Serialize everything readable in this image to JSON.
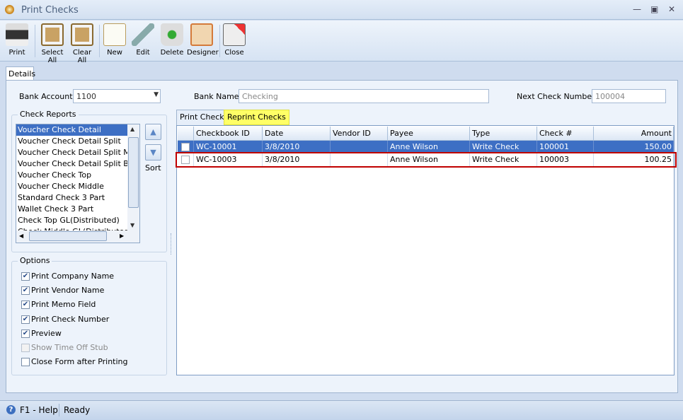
{
  "window": {
    "title": "Print Checks"
  },
  "toolbar": {
    "items": [
      {
        "label": "Print",
        "icon": "printer-icon"
      },
      {
        "label": "Select All",
        "icon": "clipboard-check-icon"
      },
      {
        "label": "Clear All",
        "icon": "clipboard-eraser-icon"
      },
      {
        "label": "New",
        "icon": "new-document-icon"
      },
      {
        "label": "Edit",
        "icon": "wrench-icon"
      },
      {
        "label": "Delete",
        "icon": "recycle-bin-icon"
      },
      {
        "label": "Designer",
        "icon": "designer-icon"
      },
      {
        "label": "Close",
        "icon": "close-window-icon"
      }
    ]
  },
  "tabs": {
    "details": "Details"
  },
  "form": {
    "bank_account_label": "Bank Account",
    "bank_account_value": "1100",
    "bank_name_label": "Bank Name",
    "bank_name_value": "Checking",
    "next_check_label": "Next Check Number",
    "next_check_value": "100004"
  },
  "check_reports": {
    "title": "Check Reports",
    "items": [
      "Voucher Check Detail",
      "Voucher Check Detail Split",
      "Voucher Check Detail Split Middle",
      "Voucher Check Detail Split Bottom",
      "Voucher Check Top",
      "Voucher Check Middle",
      "Standard Check 3 Part",
      "Wallet Check 3 Part",
      "Check Top GL(Distributed)",
      "Check Middle GL(Distributed)"
    ],
    "selected": "Voucher Check Detail",
    "sort_label": "Sort"
  },
  "options": {
    "title": "Options",
    "items": [
      {
        "label": "Print Company Name",
        "checked": true,
        "enabled": true
      },
      {
        "label": "Print Vendor Name",
        "checked": true,
        "enabled": true
      },
      {
        "label": "Print Memo Field",
        "checked": true,
        "enabled": true
      },
      {
        "label": "Print Check Number",
        "checked": true,
        "enabled": true
      },
      {
        "label": "Preview",
        "checked": true,
        "enabled": true
      },
      {
        "label": "Show Time Off Stub",
        "checked": false,
        "enabled": false
      },
      {
        "label": "Close Form after Printing",
        "checked": false,
        "enabled": true
      }
    ]
  },
  "check_tabs": {
    "print": "Print Checks",
    "reprint": "Reprint Checks",
    "active": "Reprint Checks"
  },
  "grid": {
    "columns": [
      "Checkbook ID",
      "Date",
      "Vendor ID",
      "Payee",
      "Type",
      "Check #",
      "Amount"
    ],
    "rows": [
      {
        "checkbook_id": "WC-10001",
        "date": "3/8/2010",
        "vendor_id": "",
        "payee": "Anne Wilson",
        "type": "Write Check",
        "check_no": "100001",
        "amount": "150.00",
        "selected": true
      },
      {
        "checkbook_id": "WC-10003",
        "date": "3/8/2010",
        "vendor_id": "",
        "payee": "Anne Wilson",
        "type": "Write Check",
        "check_no": "100003",
        "amount": "100.25",
        "highlighted": true
      }
    ]
  },
  "status": {
    "help": "F1 - Help",
    "state": "Ready"
  },
  "colors": {
    "selection": "#3d6fc4",
    "highlight_tab": "#ffff66",
    "highlight_box": "#c00000"
  }
}
